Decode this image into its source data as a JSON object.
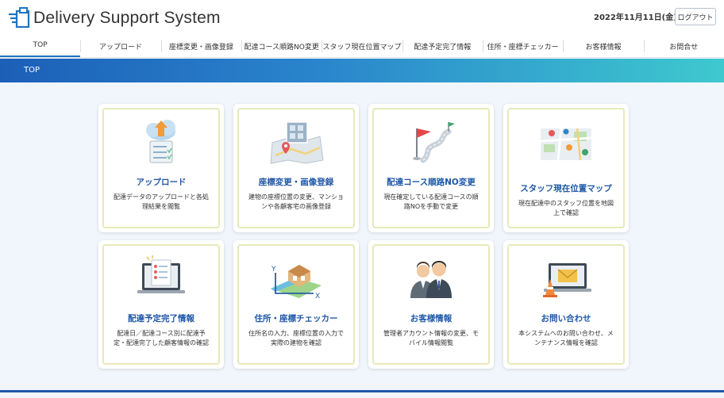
{
  "header": {
    "app_title": "Delivery Support System",
    "date": "2022年11月11日(金)",
    "logout_label": "ログアウト"
  },
  "nav": {
    "items": [
      {
        "label": "TOP"
      },
      {
        "label": "アップロード"
      },
      {
        "label": "座標変更・画像登録"
      },
      {
        "label": "配達コース順路NO変更"
      },
      {
        "label": "スタッフ現在位置マップ"
      },
      {
        "label": "配達予定完了情報"
      },
      {
        "label": "住所・座標チェッカー"
      },
      {
        "label": "お客様情報"
      },
      {
        "label": "お問合せ"
      }
    ]
  },
  "banner": {
    "title": "TOP"
  },
  "cards": [
    {
      "title": "アップロード",
      "desc": "配達データのアップロードと各処理結果を閲覧",
      "icon": "cloud-upload-icon"
    },
    {
      "title": "座標変更・画像登録",
      "desc": "建物の座標位置の変更、マンションや各顧客宅の画像登録",
      "icon": "map-image-icon"
    },
    {
      "title": "配達コース順路NO変更",
      "desc": "現在確定している配達コースの順路NOを手動で変更",
      "icon": "route-flag-icon"
    },
    {
      "title": "スタッフ現在位置マップ",
      "desc": "現在配達中のスタッフ位置を地図上で確認",
      "icon": "staff-map-icon"
    },
    {
      "title": "配達予定完了情報",
      "desc": "配達日／配達コース別に配達予定・配達完了した顧客情報の確認",
      "icon": "checklist-laptop-icon"
    },
    {
      "title": "住所・座標チェッカー",
      "desc": "住所名の入力、座標位置の入力で実際の建物を確認",
      "icon": "address-checker-icon"
    },
    {
      "title": "お客様情報",
      "desc": "管理者アカウント情報の変更、モバイル情報閲覧",
      "icon": "customers-icon"
    },
    {
      "title": "お問い合わせ",
      "desc": "本システムへのお問い合わせ、メンテナンス情報を確認",
      "icon": "mail-laptop-icon"
    }
  ],
  "colors": {
    "accent": "#1f58a8",
    "banner_start": "#1c5fb8",
    "banner_end": "#3ec9cf",
    "card_border": "#e6eab8"
  }
}
